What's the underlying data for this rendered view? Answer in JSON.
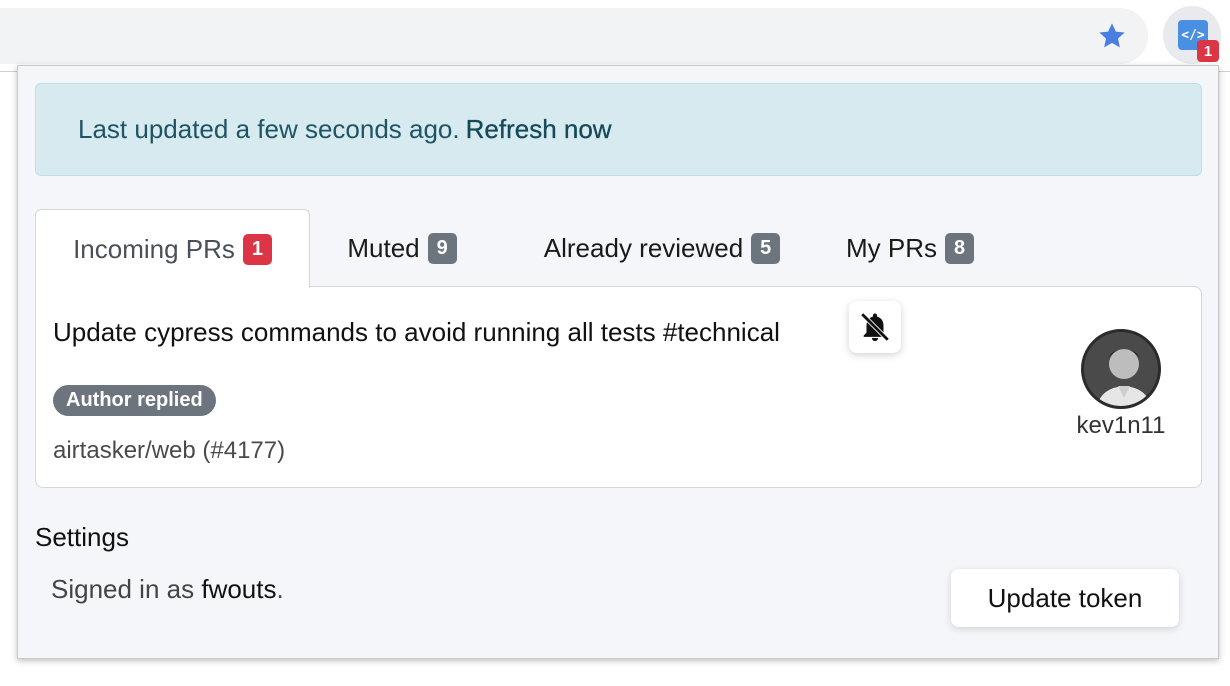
{
  "toolbar": {
    "star_icon": "star-icon",
    "extension": {
      "icon_glyph": "</>",
      "badge_count": "1"
    }
  },
  "alert": {
    "message": "Last updated a few seconds ago.",
    "refresh_label": "Refresh now"
  },
  "tabs": [
    {
      "label": "Incoming PRs",
      "count": "1",
      "active": true,
      "badge_color": "#dc3545"
    },
    {
      "label": "Muted",
      "count": "9",
      "active": false,
      "badge_color": "#6c757d"
    },
    {
      "label": "Already reviewed",
      "count": "5",
      "active": false,
      "badge_color": "#6c757d"
    },
    {
      "label": "My PRs",
      "count": "8",
      "active": false,
      "badge_color": "#6c757d"
    }
  ],
  "pr": {
    "title": "Update cypress commands to avoid running all tests #technical",
    "mute_icon": "bell-slash-icon",
    "status_pill": "Author replied",
    "repo": "airtasker/web (#4177)",
    "author": "kev1n11"
  },
  "settings": {
    "title": "Settings",
    "signed_in_prefix": "Signed in as",
    "username": "fwouts",
    "signed_in_suffix": ".",
    "update_button": "Update token"
  },
  "colors": {
    "accent_blue": "#4a90e2",
    "badge_red": "#dc3545",
    "badge_gray": "#6c757d",
    "alert_bg": "#d6eaf0"
  }
}
